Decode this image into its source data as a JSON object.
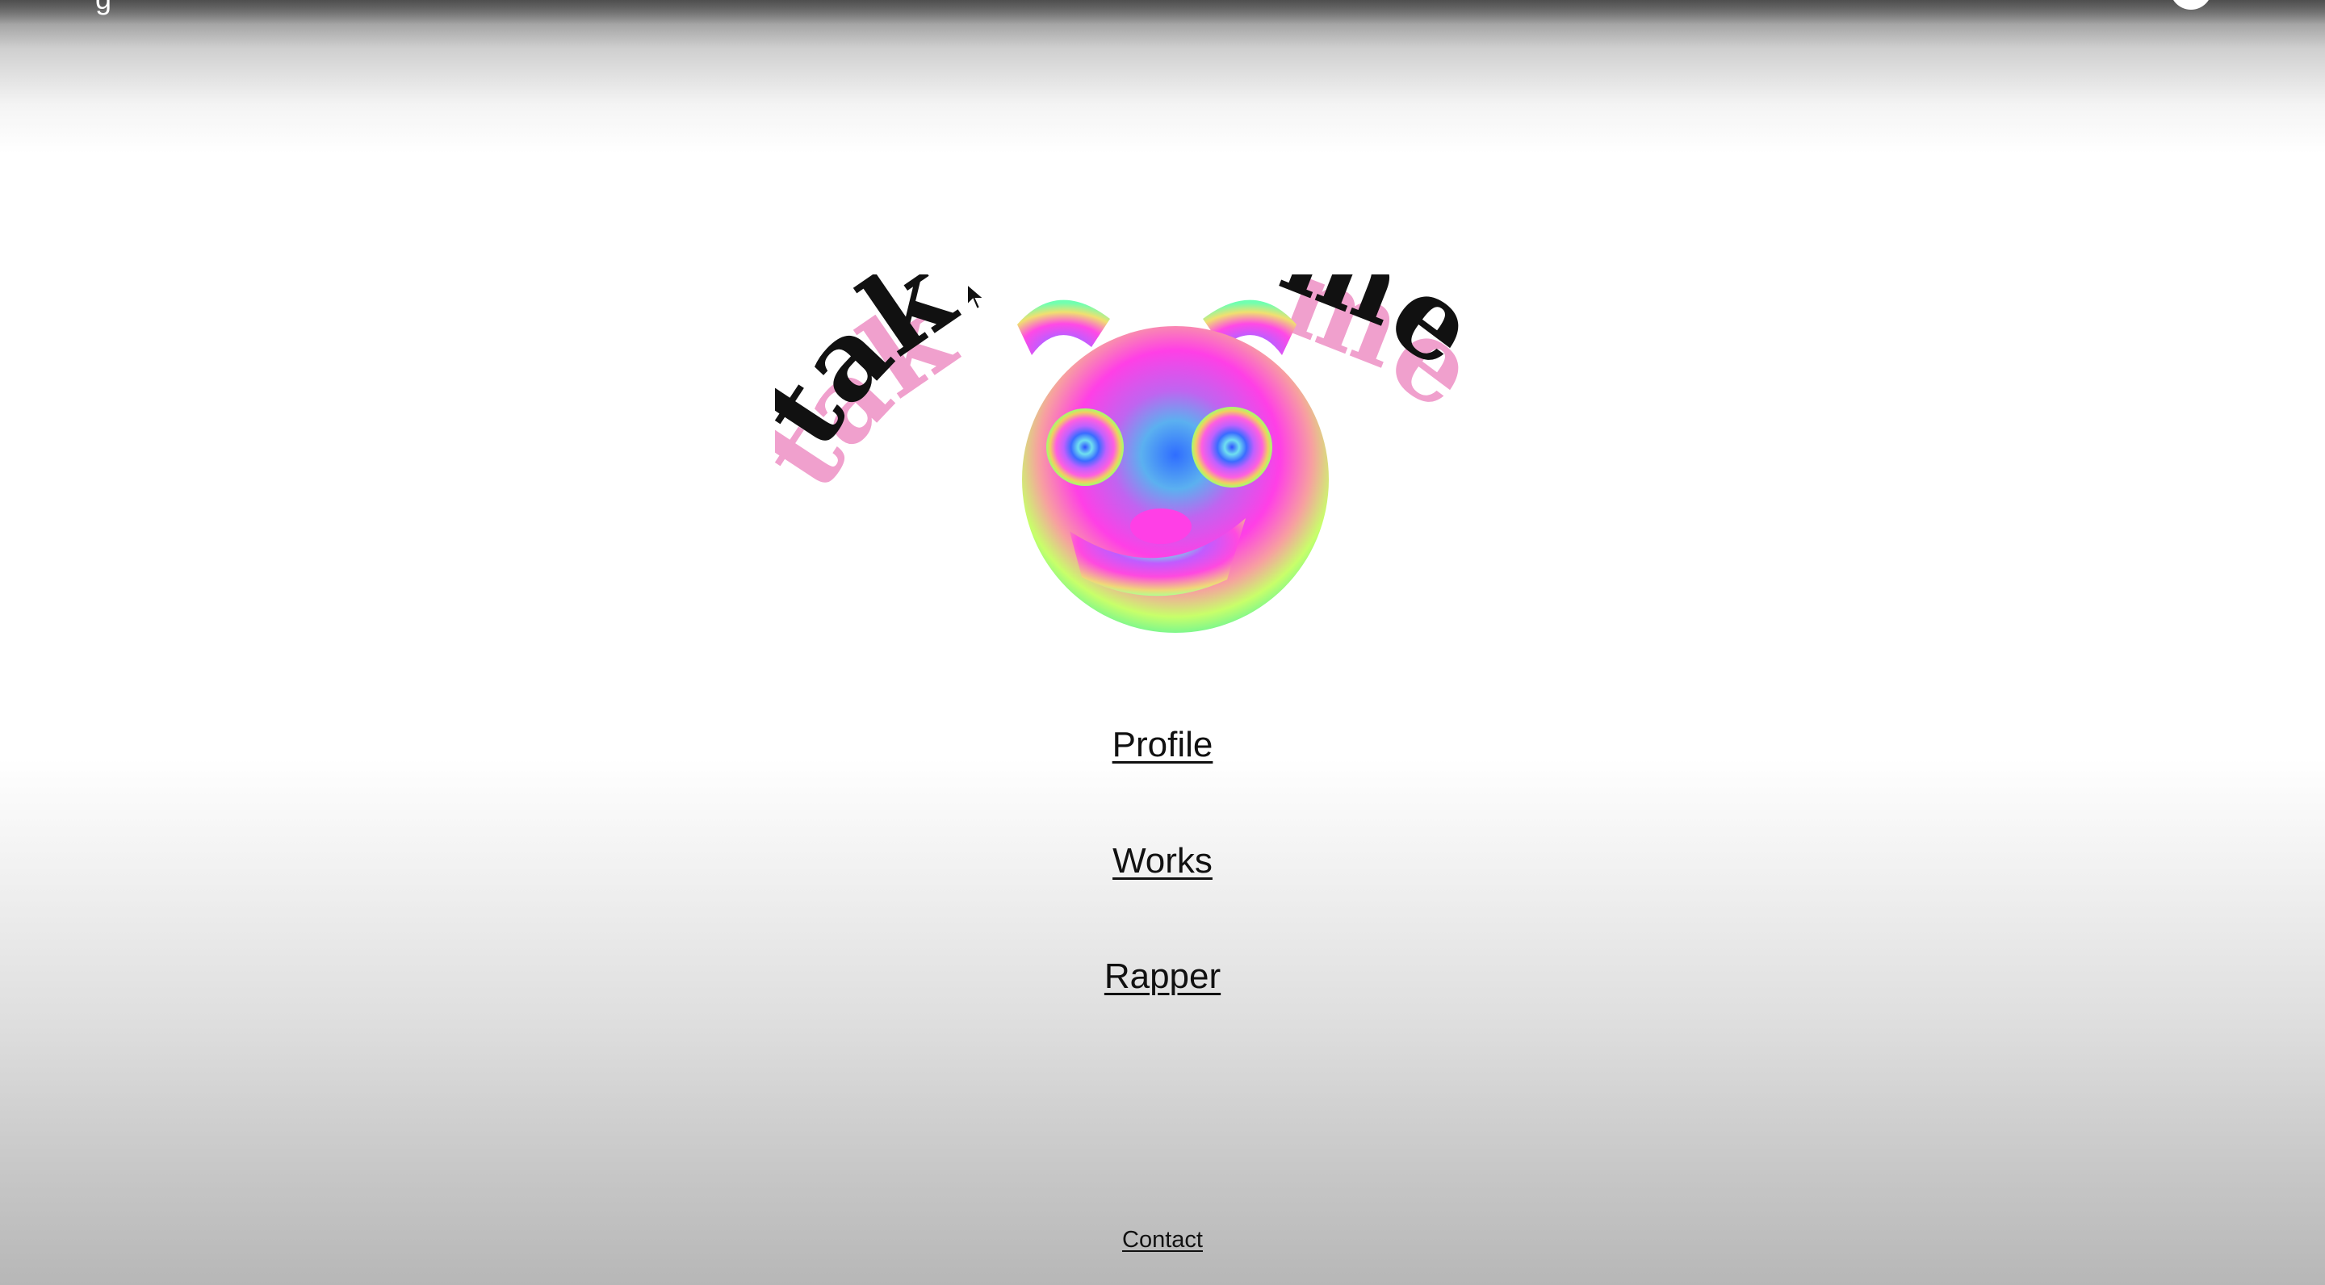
{
  "site": {
    "logo_text_left": "tak",
    "logo_text_right": "me",
    "logo_shadow_left": "tak",
    "logo_shadow_right": "me",
    "mascot_icon": "rainbow-bear-face-icon"
  },
  "nav": {
    "items": [
      {
        "label": "Profile"
      },
      {
        "label": "Works"
      },
      {
        "label": "Rapper"
      }
    ]
  },
  "footer": {
    "contact_label": "Contact"
  },
  "colors": {
    "text": "#111111",
    "shadow_pink": "#f0a0cd",
    "mascot_magenta": "#ff3ff0",
    "mascot_green": "#4dff9c",
    "mascot_blue": "#3070ff"
  }
}
